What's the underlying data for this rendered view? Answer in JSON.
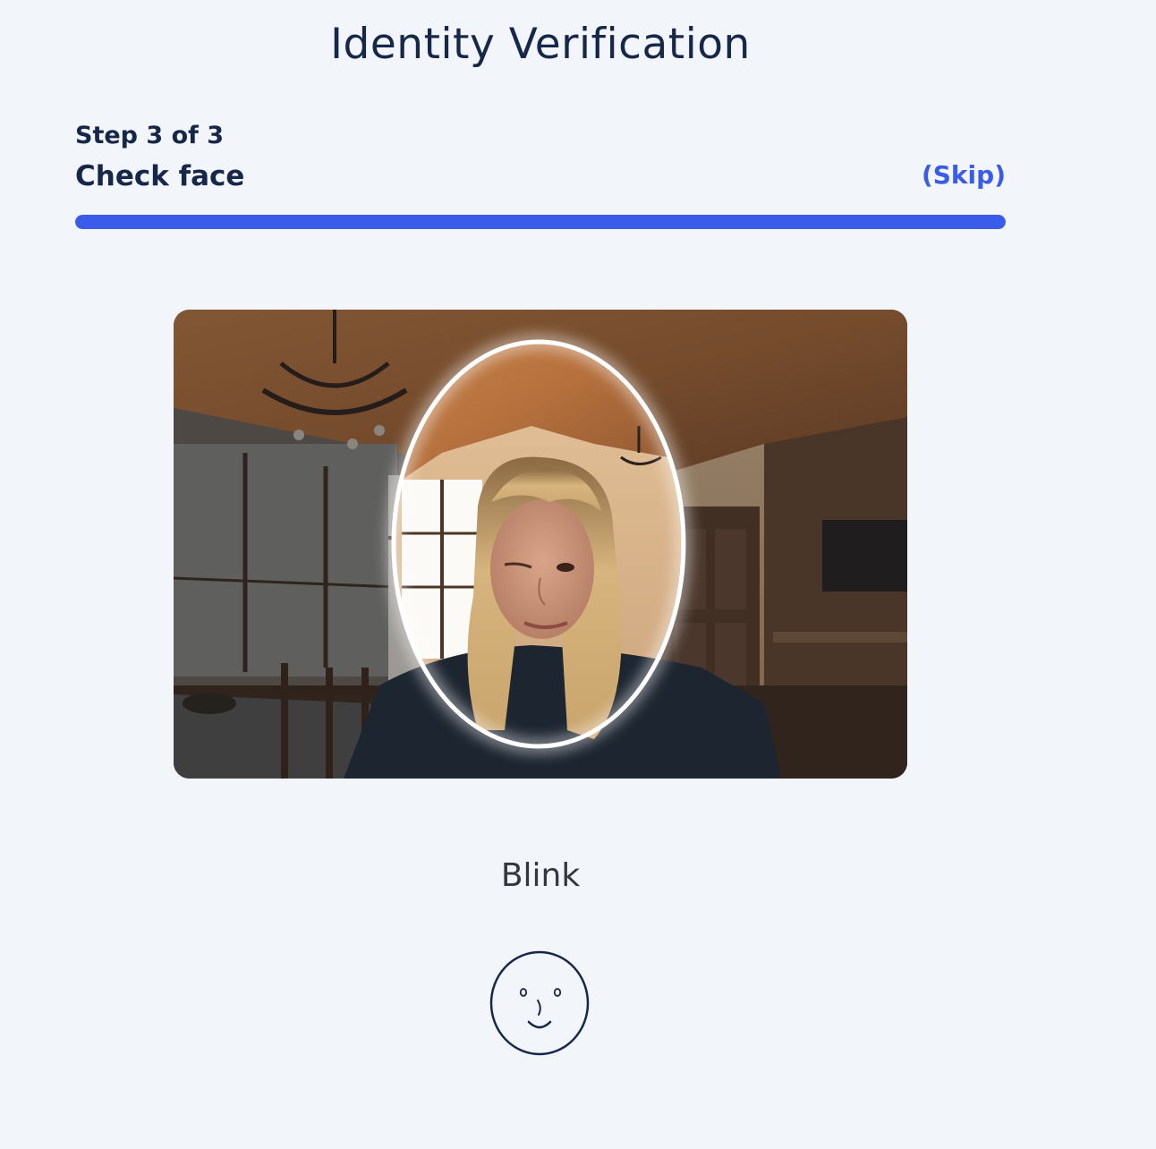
{
  "page": {
    "title": "Identity Verification"
  },
  "step": {
    "counter": "Step 3 of 3",
    "name": "Check face",
    "skip_label": "(Skip)",
    "progress": 1.0
  },
  "camera": {
    "guide": "oval-face-guide"
  },
  "instruction": {
    "text": "Blink"
  },
  "icons": {
    "instruction_icon": "smiling-face-icon"
  },
  "colors": {
    "accent": "#3b5bea",
    "text": "#16274a",
    "background": "#f2f5f9"
  }
}
